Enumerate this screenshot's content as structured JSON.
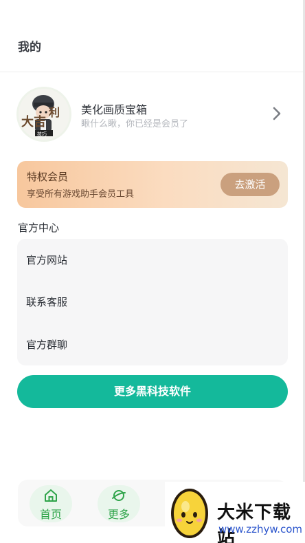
{
  "header": {
    "title": "我的"
  },
  "profile": {
    "name": "美化画质宝箱",
    "subtitle": "瞅什么瞅，你已经是会员了",
    "avatar_text": "大吉大利"
  },
  "vip": {
    "title": "特权会员",
    "subtitle": "享受所有游戏助手会员工具",
    "button": "去激活"
  },
  "official": {
    "section_title": "官方中心",
    "items": [
      {
        "label": "官方网站"
      },
      {
        "label": "联系客服"
      },
      {
        "label": "官方群聊"
      }
    ]
  },
  "cta": {
    "label": "更多黑科技软件"
  },
  "tabbar": {
    "tabs": [
      {
        "label": "首页",
        "icon": "home-icon"
      },
      {
        "label": "更多",
        "icon": "planet-icon"
      },
      {
        "label": "",
        "icon": "tab-icon"
      },
      {
        "label": "",
        "icon": "tab-icon"
      }
    ]
  },
  "watermark": {
    "text": "大米下载站",
    "url": "www.zzhyw.com"
  },
  "colors": {
    "accent": "#14b99b",
    "tab_green": "#2fa44a",
    "vip_gradient_start": "#f7c79d",
    "vip_button": "#caa07e"
  }
}
